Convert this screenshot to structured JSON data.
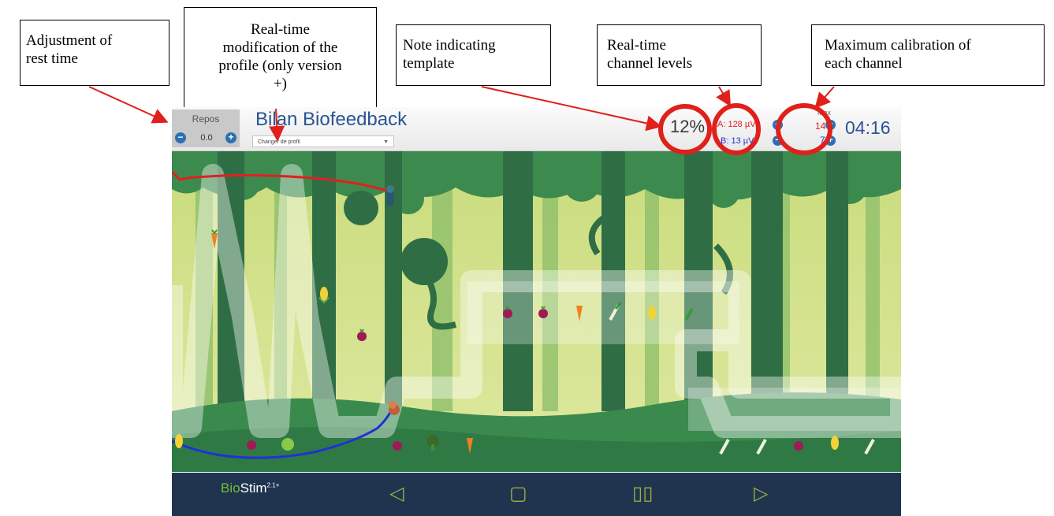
{
  "callouts": {
    "rest_time": [
      "Adjustment of",
      "rest time"
    ],
    "profile_mod": [
      "Real-time",
      "modification of the",
      "profile (only version",
      "+)"
    ],
    "template_note": [
      "Note indicating",
      "template"
    ],
    "channel_levels": [
      "Real-time",
      "channel levels"
    ],
    "max_calibration": [
      "Maximum calibration of",
      "each channel"
    ]
  },
  "topbar": {
    "repos_label": "Repos",
    "repos_value": "0.0",
    "minus": "−",
    "plus": "+",
    "title": "Bilan Biofeedback",
    "profile_select": "Changer de profil",
    "score": "12%",
    "channel_a": "A: 128 µV",
    "channel_b": "B: 13 µV",
    "max_label": "Max",
    "max_a": "146",
    "max_b": "75",
    "timer": "04:16"
  },
  "navbar": {
    "logo_bio": "Bio",
    "logo_stim": "Stim",
    "logo_version": "2.1+",
    "prev": "◁",
    "home": "▢",
    "pause": "▯▯",
    "next": "▷"
  },
  "colors": {
    "callout_arrow": "#e0201b",
    "highlight_circle": "#e0201b",
    "channel_a": "#e02020",
    "channel_b": "#2030d8",
    "navbar_bg": "#20344f",
    "title_blue": "#2a5494"
  },
  "icons": [
    "minus-icon",
    "plus-icon",
    "dropdown-caret-icon",
    "back-icon",
    "home-icon",
    "pause-icon",
    "forward-icon",
    "character-icon",
    "carrot-icon",
    "beet-icon",
    "corn-icon",
    "leek-icon",
    "apple-icon",
    "broccoli-icon"
  ]
}
